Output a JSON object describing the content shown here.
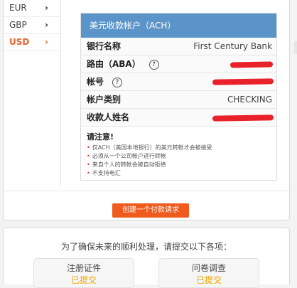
{
  "currencies": [
    {
      "code": "EUR",
      "active": false
    },
    {
      "code": "GBP",
      "active": false
    },
    {
      "code": "USD",
      "active": true
    }
  ],
  "chevron_icon": "chevron-right-icon",
  "account": {
    "header": "美元收款帐户（ACH）",
    "bank_name_label": "银行名称",
    "bank_name_value": "First Century Bank",
    "routing_label": "路由（ABA）",
    "account_no_label": "帐号",
    "account_type_label": "帐户类别",
    "account_type_value": "CHECKING",
    "payee_label": "收款人姓名",
    "help_icon": "?"
  },
  "notice": {
    "title": "请注意!",
    "items": [
      "仅ACH（美国本地银行）的美元转帐才会被接受",
      "必须从一个公司帐户进行转帐",
      "来自个人的转帐会被自动拒绝",
      "不支持电汇"
    ]
  },
  "create_button_label": "创建一个付款请求",
  "followup": {
    "message": "为了确保未来的顺利处理，请提交以下各项：",
    "documents": [
      {
        "title": "注册证件",
        "status": "已提交"
      },
      {
        "title": "问卷调查",
        "status": "已提交"
      }
    ]
  },
  "colors": {
    "accent": "#ef5a1d",
    "header_blue": "#5b94c9",
    "redaction": "#e8212a",
    "submitted": "#f0a500"
  }
}
